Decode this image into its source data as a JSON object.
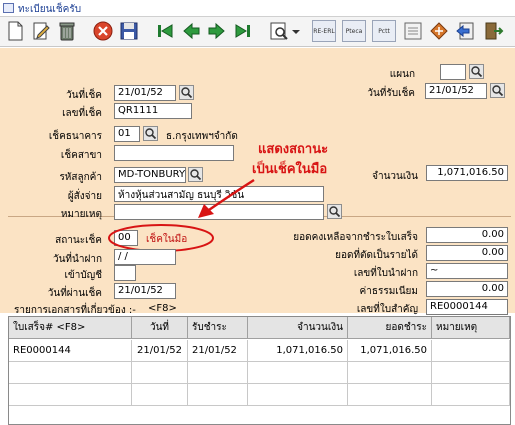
{
  "window": {
    "title": "ทะเบียนเช็ครับ"
  },
  "toolbar": {
    "icons": [
      "new-icon",
      "edit-icon",
      "trash-icon",
      "cancel-icon",
      "save-icon",
      "first-icon",
      "prev-icon",
      "next-icon",
      "last-icon",
      "print-icon",
      "dropdown-icon",
      "report1-icon",
      "report2-icon",
      "report3-icon",
      "report4-icon",
      "tools-icon",
      "back-icon",
      "exit-icon"
    ],
    "report_labels": [
      "RE-ERL",
      "Pteca",
      "Pctt"
    ]
  },
  "form": {
    "branch_label": "แผนก",
    "branch_value": "",
    "receive_date_label": "วันที่รับเช็ค",
    "receive_date_value": "21/01/52",
    "cheque_date_label": "วันที่เช็ค",
    "cheque_date_value": "21/01/52",
    "cheque_no_label": "เลขที่เช็ค",
    "cheque_no_value": "QR1111",
    "bank_label": "เช็คธนาคาร",
    "bank_code": "01",
    "bank_name": "ธ.กรุงเทพฯจำกัด",
    "bank_branch_label": "เช็คสาขา",
    "bank_branch_value": "",
    "customer_code_label": "รหัสลูกค้า",
    "customer_code_value": "MD-TONBURY",
    "payer_label": "ผู้สั่งจ่าย",
    "payer_value": "ห้างหุ้นส่วนสามัญ ธนบุรี วิชัน",
    "amount_label": "จำนวนเงิน",
    "amount_value": "1,071,016.50",
    "remark_label": "หมายเหตุ",
    "remark_value": "",
    "status_label": "สถานะเช็ค",
    "status_code": "00",
    "status_text": "เช็คในมือ",
    "deposit_date_label": "วันที่นำฝาก",
    "deposit_date_value": "/ /",
    "account_label": "เข้าบัญชี",
    "account_value": "",
    "pass_date_label": "วันที่ผ่านเช็ค",
    "pass_date_value": "21/01/52",
    "balance_label": "ยอดคงเหลือจากชำระใบเสร็จ",
    "balance_value": "0.00",
    "writeoff_label": "ยอดที่ตัดเป็นรายได้",
    "writeoff_value": "0.00",
    "deposit_no_label": "เลขที่ใบนำฝาก",
    "deposit_no_value": "~",
    "fee_label": "ค่าธรรมเนียม",
    "fee_value": "0.00",
    "voucher_label": "เลขที่ใบสำคัญ",
    "voucher_value": "RE0000144"
  },
  "annotation": {
    "line1": "แสดงสถานะ",
    "line2": "เป็นเช็คในมือ",
    "color": "#d81414"
  },
  "related": {
    "caption": "รายการเอกสารที่เกี่ยวข้อง :-",
    "shortcut": "<F8>"
  },
  "grid": {
    "headers": [
      "ใบเสร็จ# <F8>",
      "วันที่",
      "รับชำระ",
      "จำนวนเงิน",
      "ยอดชำระ",
      "หมายเหตุ"
    ],
    "rows": [
      [
        "RE0000144",
        "21/01/52",
        "21/01/52",
        "1,071,016.50",
        "1,071,016.50",
        ""
      ]
    ]
  },
  "colors": {
    "panel": "#fbe3c4",
    "title": "#1c3f94"
  }
}
